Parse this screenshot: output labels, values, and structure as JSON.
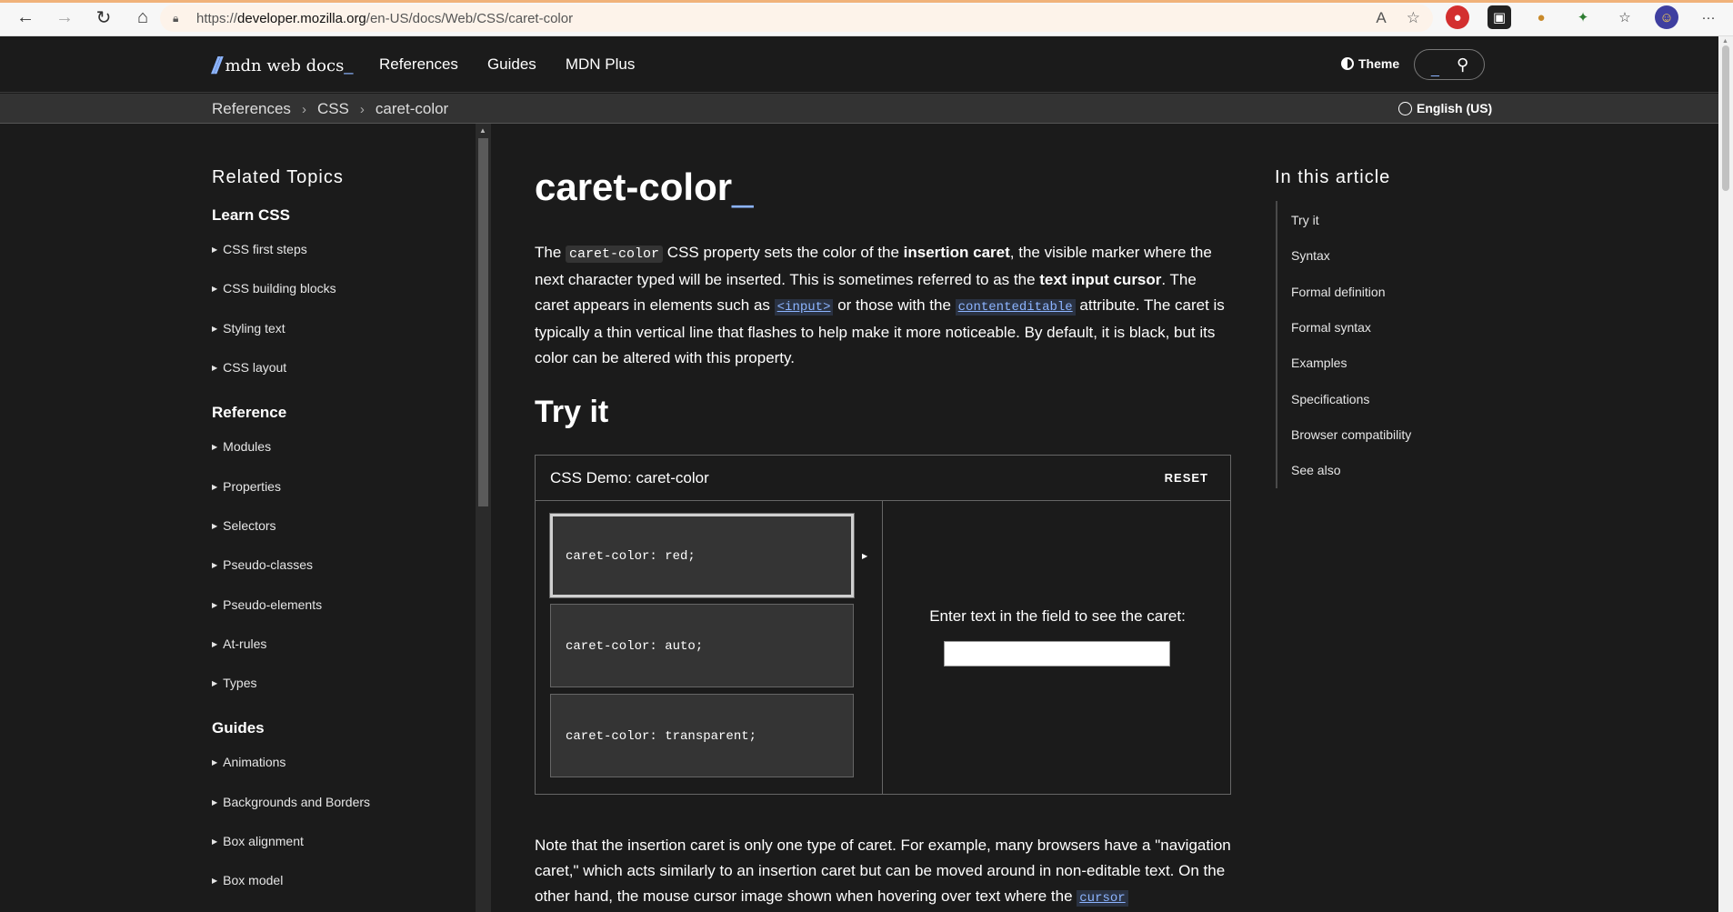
{
  "browser": {
    "url_prefix": "https://",
    "url_host": "developer.mozilla.org",
    "url_path": "/en-US/docs/Web/CSS/caret-color"
  },
  "header": {
    "logo_text": "mdn web docs",
    "logo_underscore": "_",
    "nav": [
      "References",
      "Guides",
      "MDN Plus"
    ],
    "theme_label": "Theme",
    "search_underscore": "_"
  },
  "breadcrumb": {
    "items": [
      "References",
      "CSS",
      "caret-color"
    ],
    "language": "English (US)"
  },
  "sidebar": {
    "title": "Related Topics",
    "learn_heading": "Learn CSS",
    "learn_items": [
      "CSS first steps",
      "CSS building blocks",
      "Styling text",
      "CSS layout"
    ],
    "reference_heading": "Reference",
    "reference_items": [
      "Modules",
      "Properties",
      "Selectors",
      "Pseudo-classes",
      "Pseudo-elements",
      "At-rules",
      "Types"
    ],
    "guides_heading": "Guides",
    "guides_items": [
      "Animations",
      "Backgrounds and Borders",
      "Box alignment",
      "Box model"
    ]
  },
  "article": {
    "title": "caret-color",
    "title_underscore": "_",
    "intro": {
      "p1": "The ",
      "code1": "caret-color",
      "p2": " CSS property sets the color of the ",
      "b1": "insertion caret",
      "p3": ", the visible marker where the next character typed will be inserted. This is sometimes referred to as the ",
      "b2": "text input cursor",
      "p4": ". The caret appears in elements such as ",
      "link1": "<input>",
      "p5": " or those with the ",
      "link2": "contenteditable",
      "p6": " attribute. The caret is typically a thin vertical line that flashes to help make it more noticeable. By default, it is black, but its color can be altered with this property."
    },
    "try_heading": "Try it",
    "demo": {
      "title": "CSS Demo: caret-color",
      "reset_label": "RESET",
      "options": [
        "caret-color: red;",
        "caret-color: auto;",
        "caret-color: transparent;"
      ],
      "label": "Enter text in the field to see the caret:",
      "input_value": ""
    },
    "note": {
      "text": "Note that the insertion caret is only one type of caret. For example, many browsers have a \"navigation caret,\" which acts similarly to an insertion caret but can be moved around in non-editable text. On the other hand, the mouse cursor image shown when hovering over text where the ",
      "link": "cursor"
    }
  },
  "toc": {
    "title": "In this article",
    "items": [
      "Try it",
      "Syntax",
      "Formal definition",
      "Formal syntax",
      "Examples",
      "Specifications",
      "Browser compatibility",
      "See also"
    ]
  },
  "colors": {
    "background": "#1b1b1b",
    "accent": "#8cb4ff",
    "breadcrumb_bar": "#333333"
  }
}
